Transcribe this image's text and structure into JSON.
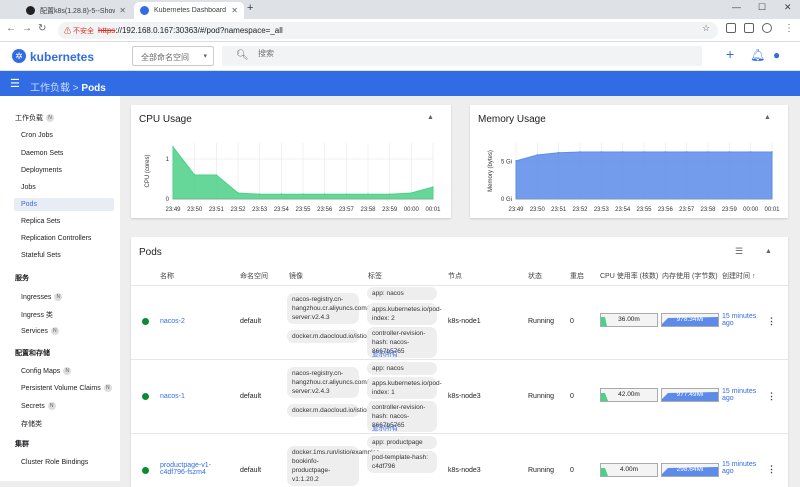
{
  "browser": {
    "tabs": [
      {
        "title": "配置k8s(1.28.8)-5--ShowDoc",
        "active": false
      },
      {
        "title": "Kubernetes Dashboard",
        "active": true
      }
    ],
    "new_tab": "+",
    "url_warning": "⚠ 不安全",
    "url_protocol": "https",
    "url_rest": "://192.168.0.167:30363/#/pod?namespace=_all"
  },
  "header": {
    "brand": "kubernetes",
    "namespace_selector": "全部命名空间",
    "search_placeholder": "搜索"
  },
  "breadcrumb": {
    "parent": "工作负载",
    "separator": ">",
    "current": "Pods"
  },
  "sidebar": {
    "workloads": {
      "label": "工作负载",
      "badge": "N"
    },
    "items_workloads": [
      "Cron Jobs",
      "Daemon Sets",
      "Deployments",
      "Jobs",
      "Pods",
      "Replica Sets",
      "Replication Controllers",
      "Stateful Sets"
    ],
    "service": {
      "label": "服务"
    },
    "ingresses": {
      "label": "Ingresses",
      "badge": "N"
    },
    "ingress_class": "Ingress 类",
    "services": {
      "label": "Services",
      "badge": "N"
    },
    "config": {
      "label": "配置和存储"
    },
    "config_maps": {
      "label": "Config Maps",
      "badge": "N"
    },
    "pvc": {
      "label": "Persistent Volume Claims",
      "badge": "N"
    },
    "secrets": {
      "label": "Secrets",
      "badge": "N"
    },
    "storage_class": "存储类",
    "cluster": {
      "label": "集群"
    },
    "crb": "Cluster Role Bindings"
  },
  "cpu_chart": {
    "title": "CPU Usage",
    "ylabel": "CPU (cores)",
    "y_ticks": [
      "1",
      "0"
    ],
    "x_ticks": [
      "23:49",
      "23:50",
      "23:51",
      "23:52",
      "23:53",
      "23:54",
      "23:55",
      "23:56",
      "23:57",
      "23:58",
      "23:59",
      "00:00",
      "00:01"
    ]
  },
  "memory_chart": {
    "title": "Memory Usage",
    "ylabel": "Memory (bytes)",
    "y_ticks": [
      "5 Gi",
      "0 Gi"
    ],
    "x_ticks": [
      "23:49",
      "23:50",
      "23:51",
      "23:52",
      "23:53",
      "23:54",
      "23:55",
      "23:56",
      "23:57",
      "23:58",
      "23:59",
      "00:00",
      "00:01"
    ]
  },
  "chart_data": [
    {
      "type": "area",
      "title": "CPU Usage",
      "ylabel": "CPU (cores)",
      "ylim": [
        0,
        1.4
      ],
      "x": [
        "23:49",
        "23:50",
        "23:51",
        "23:52",
        "23:53",
        "23:54",
        "23:55",
        "23:56",
        "23:57",
        "23:58",
        "23:59",
        "00:00",
        "00:01"
      ],
      "series": [
        {
          "values": [
            1.3,
            0.6,
            0.6,
            0.15,
            0.12,
            0.12,
            0.12,
            0.12,
            0.12,
            0.12,
            0.12,
            0.15,
            0.3
          ]
        }
      ],
      "color": "#4cd087"
    },
    {
      "type": "area",
      "title": "Memory Usage",
      "ylabel": "Memory (bytes)",
      "ylim": [
        0,
        7.5
      ],
      "x": [
        "23:49",
        "23:50",
        "23:51",
        "23:52",
        "23:53",
        "23:54",
        "23:55",
        "23:56",
        "23:57",
        "23:58",
        "23:59",
        "00:00",
        "00:01"
      ],
      "series": [
        {
          "values": [
            5.1,
            5.9,
            6.2,
            6.3,
            6.3,
            6.3,
            6.3,
            6.3,
            6.3,
            6.3,
            6.3,
            6.3,
            6.3
          ]
        }
      ],
      "color": "#5c8be9"
    }
  ],
  "pods": {
    "title": "Pods",
    "columns": [
      "名称",
      "命名空间",
      "镜像",
      "标签",
      "节点",
      "状态",
      "重启",
      "CPU 使用率 (核数)",
      "内存使用 (字节数)",
      "创建时间 ↑"
    ],
    "rows": [
      {
        "name": "nacos-2",
        "namespace": "default",
        "image1": "nacos-registry.cn-hangzhou.cr.aliyuncs.com/nacos/nacos-server:v2.4.3",
        "image2": "docker.m.daocloud.io/istio/proxyv2:1.24.1",
        "label1": "app: nacos",
        "label2": "apps.kubernetes.io/pod-index: 2",
        "label3": "controller-revision-hash: nacos-8667b5765",
        "show_all": "显示所有",
        "node": "k8s-node1",
        "status": "Running",
        "restarts": "0",
        "cpu": "36.00m",
        "memory": "978.34Mi",
        "created": "15 minutes ago"
      },
      {
        "name": "nacos-1",
        "namespace": "default",
        "image1": "nacos-registry.cn-hangzhou.cr.aliyuncs.com/nacos/nacos-server:v2.4.3",
        "image2": "docker.m.daocloud.io/istio/proxyv2:1.24.1",
        "label1": "app: nacos",
        "label2": "apps.kubernetes.io/pod-index: 1",
        "label3": "controller-revision-hash: nacos-8667b5765",
        "show_all": "显示所有",
        "node": "k8s-node3",
        "status": "Running",
        "restarts": "0",
        "cpu": "42.00m",
        "memory": "977.49Mi",
        "created": "15 minutes ago"
      },
      {
        "name": "productpage-v1-c4df796-fszm4",
        "namespace": "default",
        "image1": "docker.1ms.run/istio/examples-bookinfo-productpage-v1:1.20.2",
        "label1": "app: productpage",
        "label2": "pod-template-hash: c4df796",
        "node": "k8s-node3",
        "status": "Running",
        "restarts": "0",
        "cpu": "4.00m",
        "memory": "298.64Mi",
        "created": "15 minutes ago"
      }
    ]
  }
}
